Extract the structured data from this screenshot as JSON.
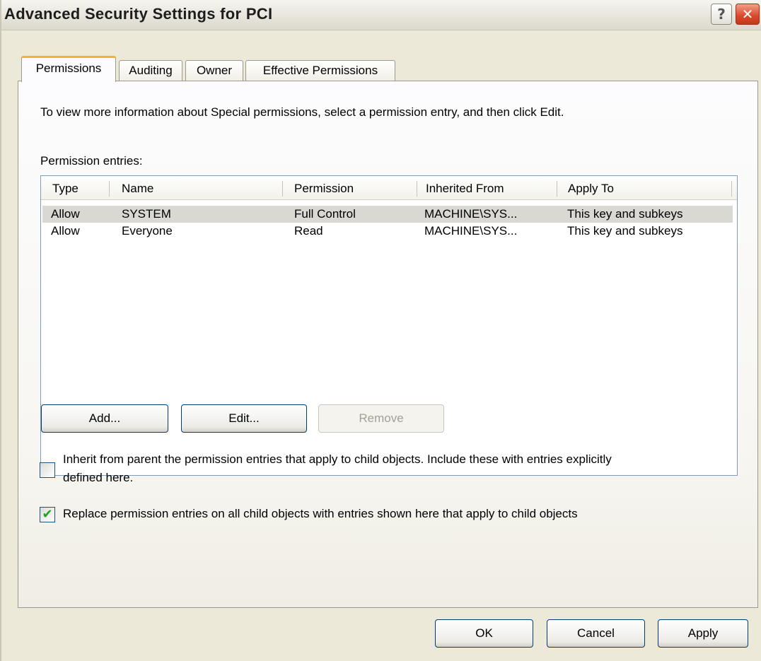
{
  "window": {
    "title": "Advanced Security Settings for PCI",
    "help_glyph": "?",
    "close_glyph": "✕"
  },
  "tabs": [
    {
      "label": "Permissions",
      "active": true
    },
    {
      "label": "Auditing",
      "active": false
    },
    {
      "label": "Owner",
      "active": false
    },
    {
      "label": "Effective Permissions",
      "active": false
    }
  ],
  "permissions": {
    "instruction": "To view more information about Special permissions, select a permission entry, and then click Edit.",
    "entries_label": "Permission entries:",
    "columns": [
      "Type",
      "Name",
      "Permission",
      "Inherited From",
      "Apply To"
    ],
    "rows": [
      {
        "type": "Allow",
        "name": "SYSTEM",
        "permission": "Full Control",
        "inherited_from": "MACHINE\\SYS...",
        "apply_to": "This key and subkeys",
        "selected": true
      },
      {
        "type": "Allow",
        "name": "Everyone",
        "permission": "Read",
        "inherited_from": "MACHINE\\SYS...",
        "apply_to": "This key and subkeys",
        "selected": false
      }
    ],
    "buttons": {
      "add": "Add...",
      "edit": "Edit...",
      "remove": "Remove"
    },
    "inherit_checkbox": {
      "line1": "Inherit from parent the permission entries that apply to child objects. Include these with entries explicitly",
      "line2": "defined here.",
      "checked": false
    },
    "replace_checkbox": {
      "label": "Replace permission entries on all child objects with entries shown here that apply to child objects",
      "checked": true
    }
  },
  "footer": {
    "ok": "OK",
    "cancel": "Cancel",
    "apply": "Apply"
  },
  "colors": {
    "tab_accent": "#f5b12e",
    "dialog_bg": "#ece9d8",
    "button_border": "#003c74",
    "checkmark": "#21a121"
  }
}
